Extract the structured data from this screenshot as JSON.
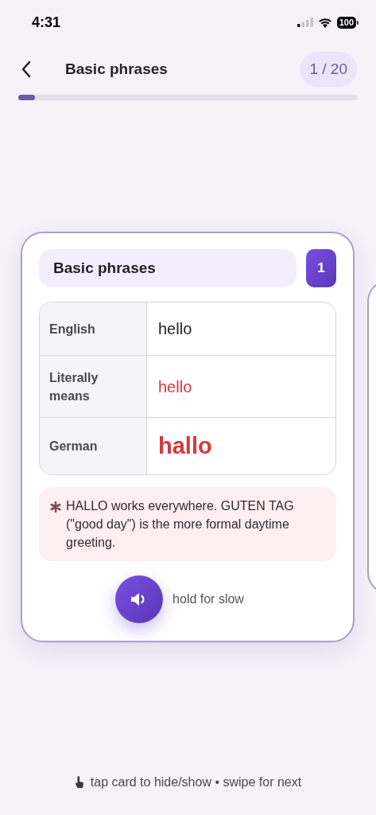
{
  "status_bar": {
    "time": "4:31",
    "battery": "100"
  },
  "header": {
    "title": "Basic phrases",
    "counter": "1 / 20"
  },
  "progress": {
    "level": 0.05
  },
  "card": {
    "deck": "Basic phrases",
    "number": "1",
    "rows": [
      {
        "kind": "plain",
        "label": "English",
        "value": "hello"
      },
      {
        "kind": "literal",
        "label": "Literally means",
        "value": "hello"
      },
      {
        "kind": "target",
        "label": "German",
        "value": "hallo"
      }
    ],
    "note": "HALLO works everywhere. GUTEN TAG (\"good day\") is the more formal daytime greeting.",
    "audio_hint": "hold for slow"
  },
  "footer": {
    "hint": "tap card to hide/show • swipe for next"
  }
}
